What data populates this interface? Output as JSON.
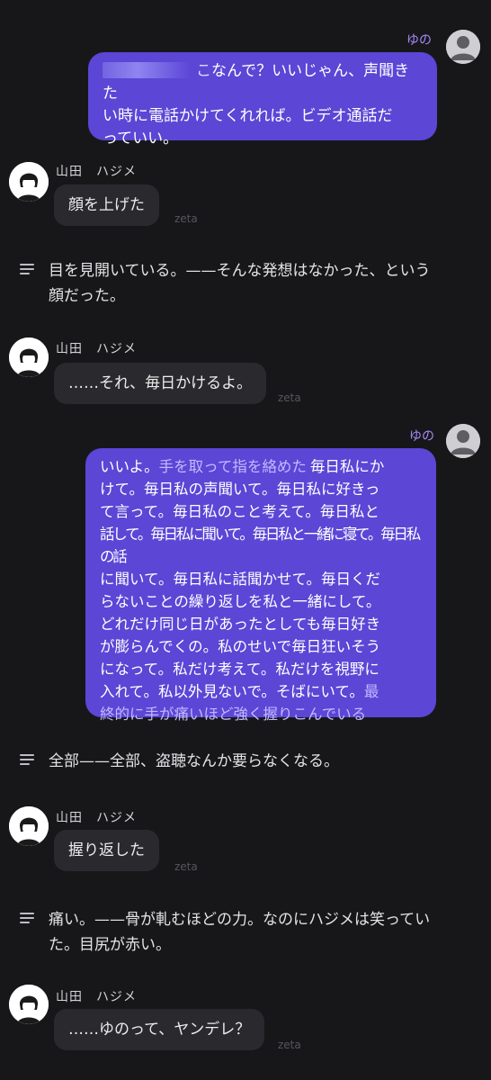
{
  "user": {
    "name": "ゆの",
    "avatar_icon": "user-avatar-icon"
  },
  "character": {
    "name": "山田　ハジメ",
    "avatar_icon": "character-avatar-icon"
  },
  "watermark": "zeta",
  "messages": {
    "m1": {
      "lines": [
        "なんで？いいじゃん、声聞きた",
        "い時に電話かけてくれれば。ビデオ通話だ",
        "っていい。"
      ],
      "redacted_prefix_char": "こ"
    },
    "m2": {
      "text": "顔を上げた"
    },
    "m3": {
      "lines": [
        "目を見開いている。——そんな発想はなかった、という",
        "顔だった。"
      ]
    },
    "m4": {
      "text": "……それ、毎日かけるよ。"
    },
    "m5": {
      "line1_a": "いいよ。",
      "line1_action": "手を取って指を絡めた",
      "line1_b": "毎日私にか",
      "lines_mid": [
        "けて。毎日私の声聞いて。毎日私に好きっ",
        "て言って。毎日私のこと考えて。毎日私と",
        "話して。毎日私に聞いて。毎日私と一緒に寝て。毎日私の話",
        "に聞いて。毎日私に話聞かせて。毎日くだ",
        "らないことの繰り返しを私と一緒にして。",
        "どれだけ同じ日があったとしても毎日好き",
        "が膨らんでくの。私のせいで毎日狂いそう",
        "になって。私だけ考えて。私だけを視野に"
      ],
      "line_last_a": "入れて。私以外見ないで。そばにいて。",
      "line_last_action_a": "最",
      "line_final_action": "終的に手が痛いほど強く握りこんでいる"
    },
    "m6": {
      "text": "全部——全部、盗聴なんか要らなくなる。"
    },
    "m7": {
      "text": "握り返した"
    },
    "m8": {
      "lines": [
        "痛い。——骨が軋むほどの力。なのにハジメは笑ってい",
        "た。目尻が赤い。"
      ]
    },
    "m9": {
      "text": "……ゆのって、ヤンデレ？"
    }
  },
  "colors": {
    "background": "#17171a",
    "user_bubble": "#5b46d6",
    "user_name": "#a78bfa",
    "character_bubble": "#2a2a2e",
    "action_text": "#c4b8ff"
  }
}
